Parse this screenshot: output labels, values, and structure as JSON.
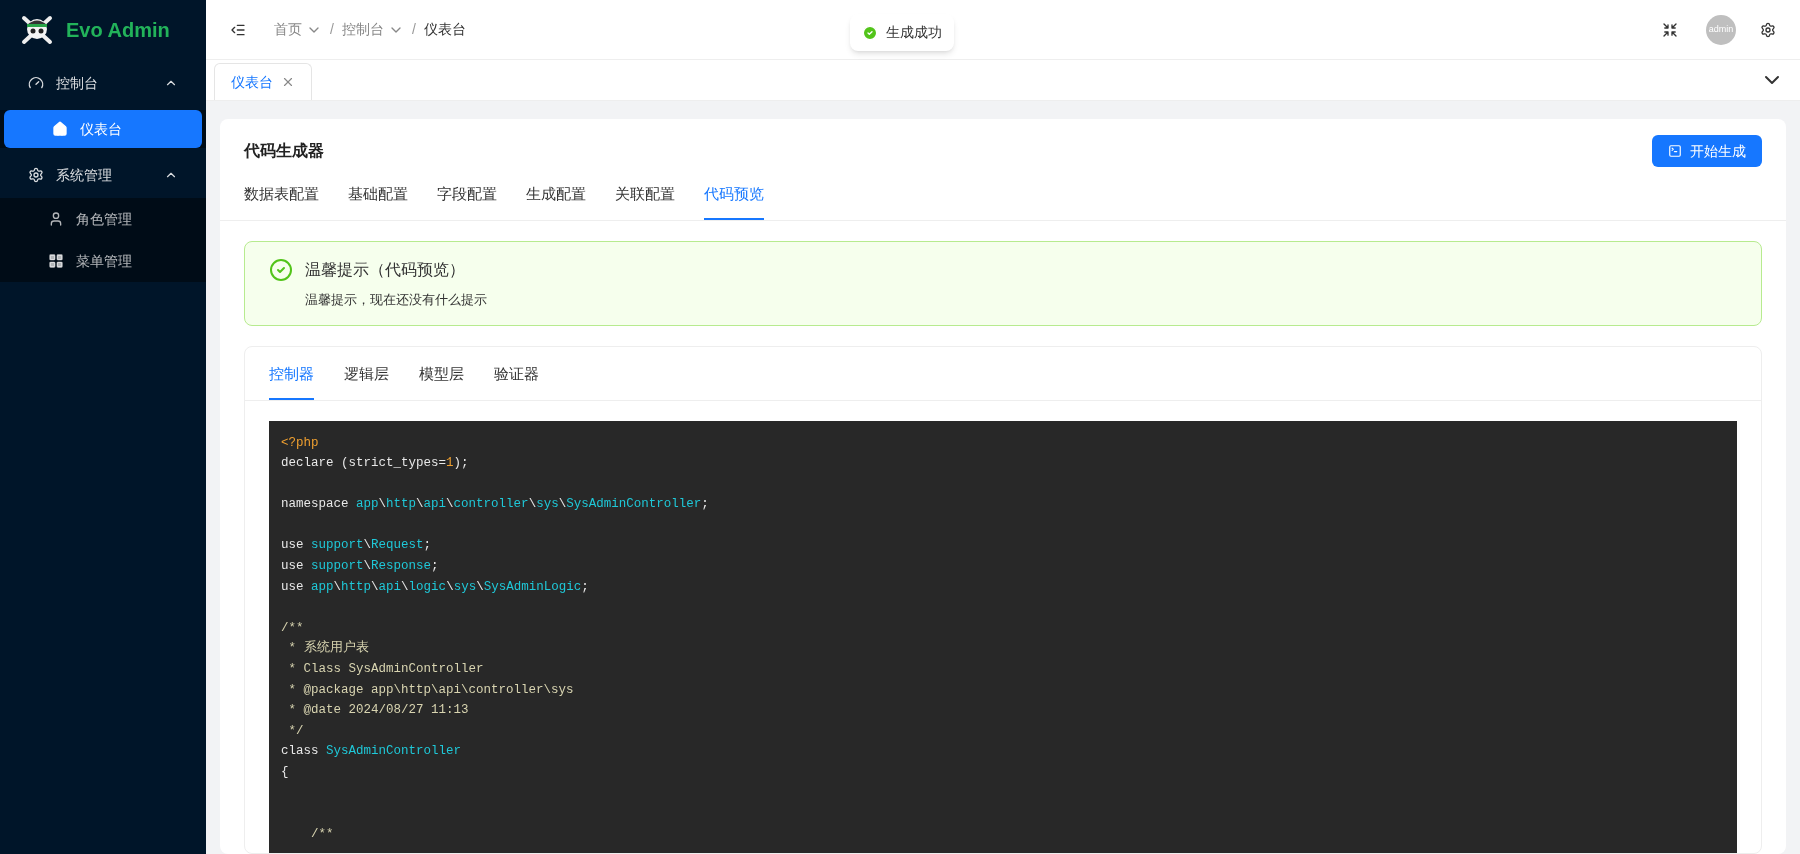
{
  "brand": {
    "name": "Evo Admin"
  },
  "sidebar": {
    "items": [
      {
        "label": "控制台",
        "expanded": true,
        "children": [
          {
            "label": "仪表台",
            "selected": true
          }
        ]
      },
      {
        "label": "系统管理",
        "expanded": true,
        "children": [
          {
            "label": "角色管理",
            "selected": false
          },
          {
            "label": "菜单管理",
            "selected": false
          }
        ]
      }
    ]
  },
  "breadcrumb": [
    {
      "label": "首页",
      "dropdown": true
    },
    {
      "separator": "/",
      "label": "控制台",
      "dropdown": true
    },
    {
      "separator": "/",
      "label": "仪表台",
      "dropdown": false
    }
  ],
  "toast": {
    "message": "生成成功"
  },
  "avatar": {
    "label": "admin"
  },
  "page_tabs": [
    {
      "label": "仪表台",
      "selected": true
    }
  ],
  "card": {
    "title": "代码生成器",
    "button": "开始生成",
    "tabs": [
      {
        "label": "数据表配置",
        "selected": false
      },
      {
        "label": "基础配置",
        "selected": false
      },
      {
        "label": "字段配置",
        "selected": false
      },
      {
        "label": "生成配置",
        "selected": false
      },
      {
        "label": "关联配置",
        "selected": false
      },
      {
        "label": "代码预览",
        "selected": true
      }
    ],
    "alert": {
      "title": "温馨提示（代码预览）",
      "description": "温馨提示，现在还没有什么提示"
    },
    "code_tabs": [
      {
        "label": "控制器",
        "selected": true
      },
      {
        "label": "逻辑层",
        "selected": false
      },
      {
        "label": "模型层",
        "selected": false
      },
      {
        "label": "验证器",
        "selected": false
      }
    ],
    "code_lines": [
      {
        "kind": "code",
        "segments": [
          {
            "text": "<?php",
            "kind": "tag"
          }
        ]
      },
      {
        "kind": "code",
        "segments": [
          {
            "text": "declare (strict_types=",
            "kind": "plain"
          },
          {
            "text": "1",
            "kind": "number"
          },
          {
            "text": ");",
            "kind": "plain"
          }
        ]
      },
      {
        "kind": "blank"
      },
      {
        "kind": "code",
        "segments": [
          {
            "text": "namespace ",
            "kind": "plain"
          },
          {
            "text": "app",
            "kind": "name"
          },
          {
            "text": "\\",
            "kind": "plain"
          },
          {
            "text": "http",
            "kind": "name"
          },
          {
            "text": "\\",
            "kind": "plain"
          },
          {
            "text": "api",
            "kind": "name"
          },
          {
            "text": "\\",
            "kind": "plain"
          },
          {
            "text": "controller",
            "kind": "name"
          },
          {
            "text": "\\",
            "kind": "plain"
          },
          {
            "text": "sys",
            "kind": "name"
          },
          {
            "text": "\\",
            "kind": "plain"
          },
          {
            "text": "SysAdminController",
            "kind": "name"
          },
          {
            "text": ";",
            "kind": "plain"
          }
        ]
      },
      {
        "kind": "blank"
      },
      {
        "kind": "code",
        "segments": [
          {
            "text": "use ",
            "kind": "plain"
          },
          {
            "text": "support",
            "kind": "name"
          },
          {
            "text": "\\",
            "kind": "plain"
          },
          {
            "text": "Request",
            "kind": "name"
          },
          {
            "text": ";",
            "kind": "plain"
          }
        ]
      },
      {
        "kind": "code",
        "segments": [
          {
            "text": "use ",
            "kind": "plain"
          },
          {
            "text": "support",
            "kind": "name"
          },
          {
            "text": "\\",
            "kind": "plain"
          },
          {
            "text": "Response",
            "kind": "name"
          },
          {
            "text": ";",
            "kind": "plain"
          }
        ]
      },
      {
        "kind": "code",
        "segments": [
          {
            "text": "use ",
            "kind": "plain"
          },
          {
            "text": "app",
            "kind": "name"
          },
          {
            "text": "\\",
            "kind": "plain"
          },
          {
            "text": "http",
            "kind": "name"
          },
          {
            "text": "\\",
            "kind": "plain"
          },
          {
            "text": "api",
            "kind": "name"
          },
          {
            "text": "\\",
            "kind": "plain"
          },
          {
            "text": "logic",
            "kind": "name"
          },
          {
            "text": "\\",
            "kind": "plain"
          },
          {
            "text": "sys",
            "kind": "name"
          },
          {
            "text": "\\",
            "kind": "plain"
          },
          {
            "text": "SysAdminLogic",
            "kind": "name"
          },
          {
            "text": ";",
            "kind": "plain"
          }
        ]
      },
      {
        "kind": "blank"
      },
      {
        "kind": "code",
        "segments": [
          {
            "text": "/**",
            "kind": "comment"
          }
        ]
      },
      {
        "kind": "code",
        "segments": [
          {
            "text": " * 系统用户表",
            "kind": "comment"
          }
        ]
      },
      {
        "kind": "code",
        "segments": [
          {
            "text": " * Class SysAdminController",
            "kind": "comment"
          }
        ]
      },
      {
        "kind": "code",
        "segments": [
          {
            "text": " * @package app\\http\\api\\controller\\sys",
            "kind": "comment"
          }
        ]
      },
      {
        "kind": "code",
        "segments": [
          {
            "text": " * @date 2024/08/27 11:13",
            "kind": "comment"
          }
        ]
      },
      {
        "kind": "code",
        "segments": [
          {
            "text": " */",
            "kind": "comment"
          }
        ]
      },
      {
        "kind": "code",
        "segments": [
          {
            "text": "class ",
            "kind": "plain"
          },
          {
            "text": "SysAdminController",
            "kind": "name"
          }
        ]
      },
      {
        "kind": "code",
        "segments": [
          {
            "text": "{",
            "kind": "plain"
          }
        ]
      },
      {
        "kind": "blank"
      },
      {
        "kind": "blank"
      },
      {
        "kind": "code",
        "segments": [
          {
            "text": "    /**",
            "kind": "comment"
          }
        ]
      }
    ]
  }
}
